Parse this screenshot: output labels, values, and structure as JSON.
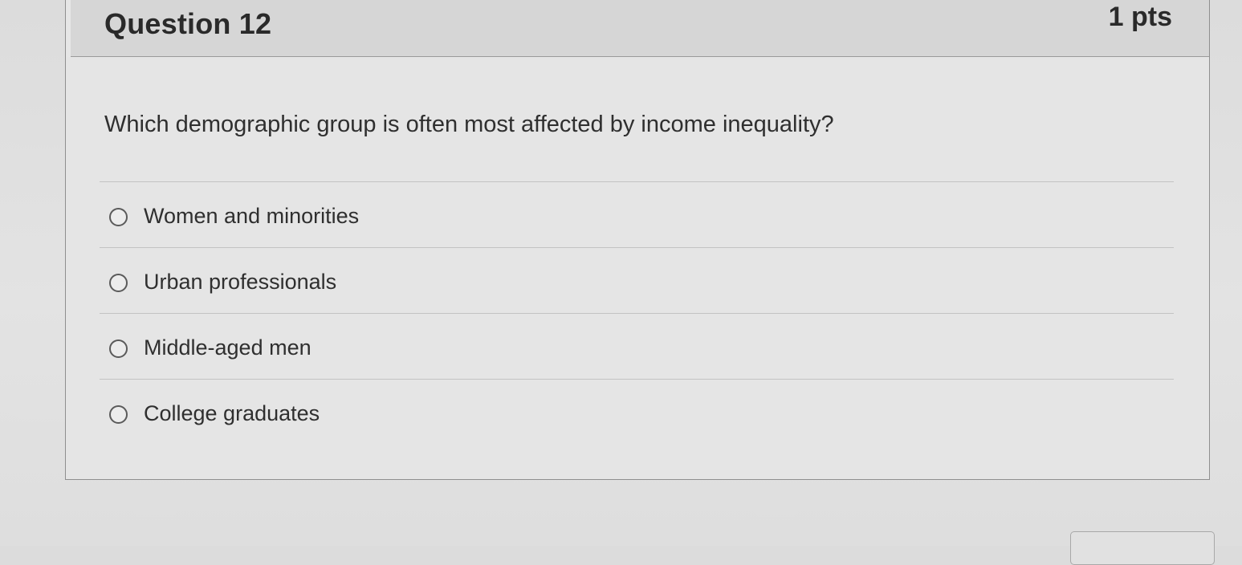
{
  "question": {
    "title": "Question 12",
    "points": "1 pts",
    "text": "Which demographic group is often most affected by income inequality?",
    "answers": [
      {
        "label": "Women and minorities",
        "selected": false
      },
      {
        "label": "Urban professionals",
        "selected": false
      },
      {
        "label": "Middle-aged men",
        "selected": false
      },
      {
        "label": "College graduates",
        "selected": false
      }
    ]
  },
  "colors": {
    "background": "#dcdcdc",
    "header": "#d6d6d6",
    "text": "#2f2f2f",
    "border": "#8f8f8f"
  }
}
